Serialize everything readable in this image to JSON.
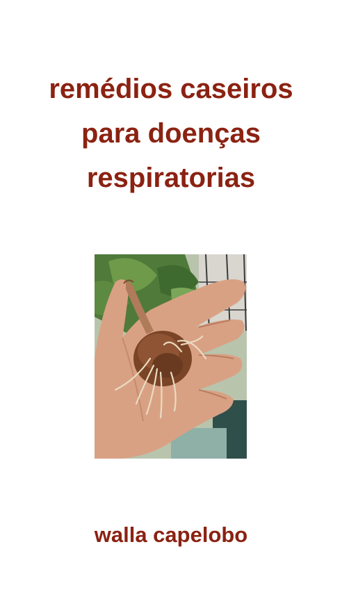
{
  "cover": {
    "title_lines": [
      "remédios caseiros",
      "para doenças",
      "respiratorias"
    ],
    "author": "walla capelobo",
    "colors": {
      "text": "#8b2212",
      "background": "#ffffff"
    }
  }
}
